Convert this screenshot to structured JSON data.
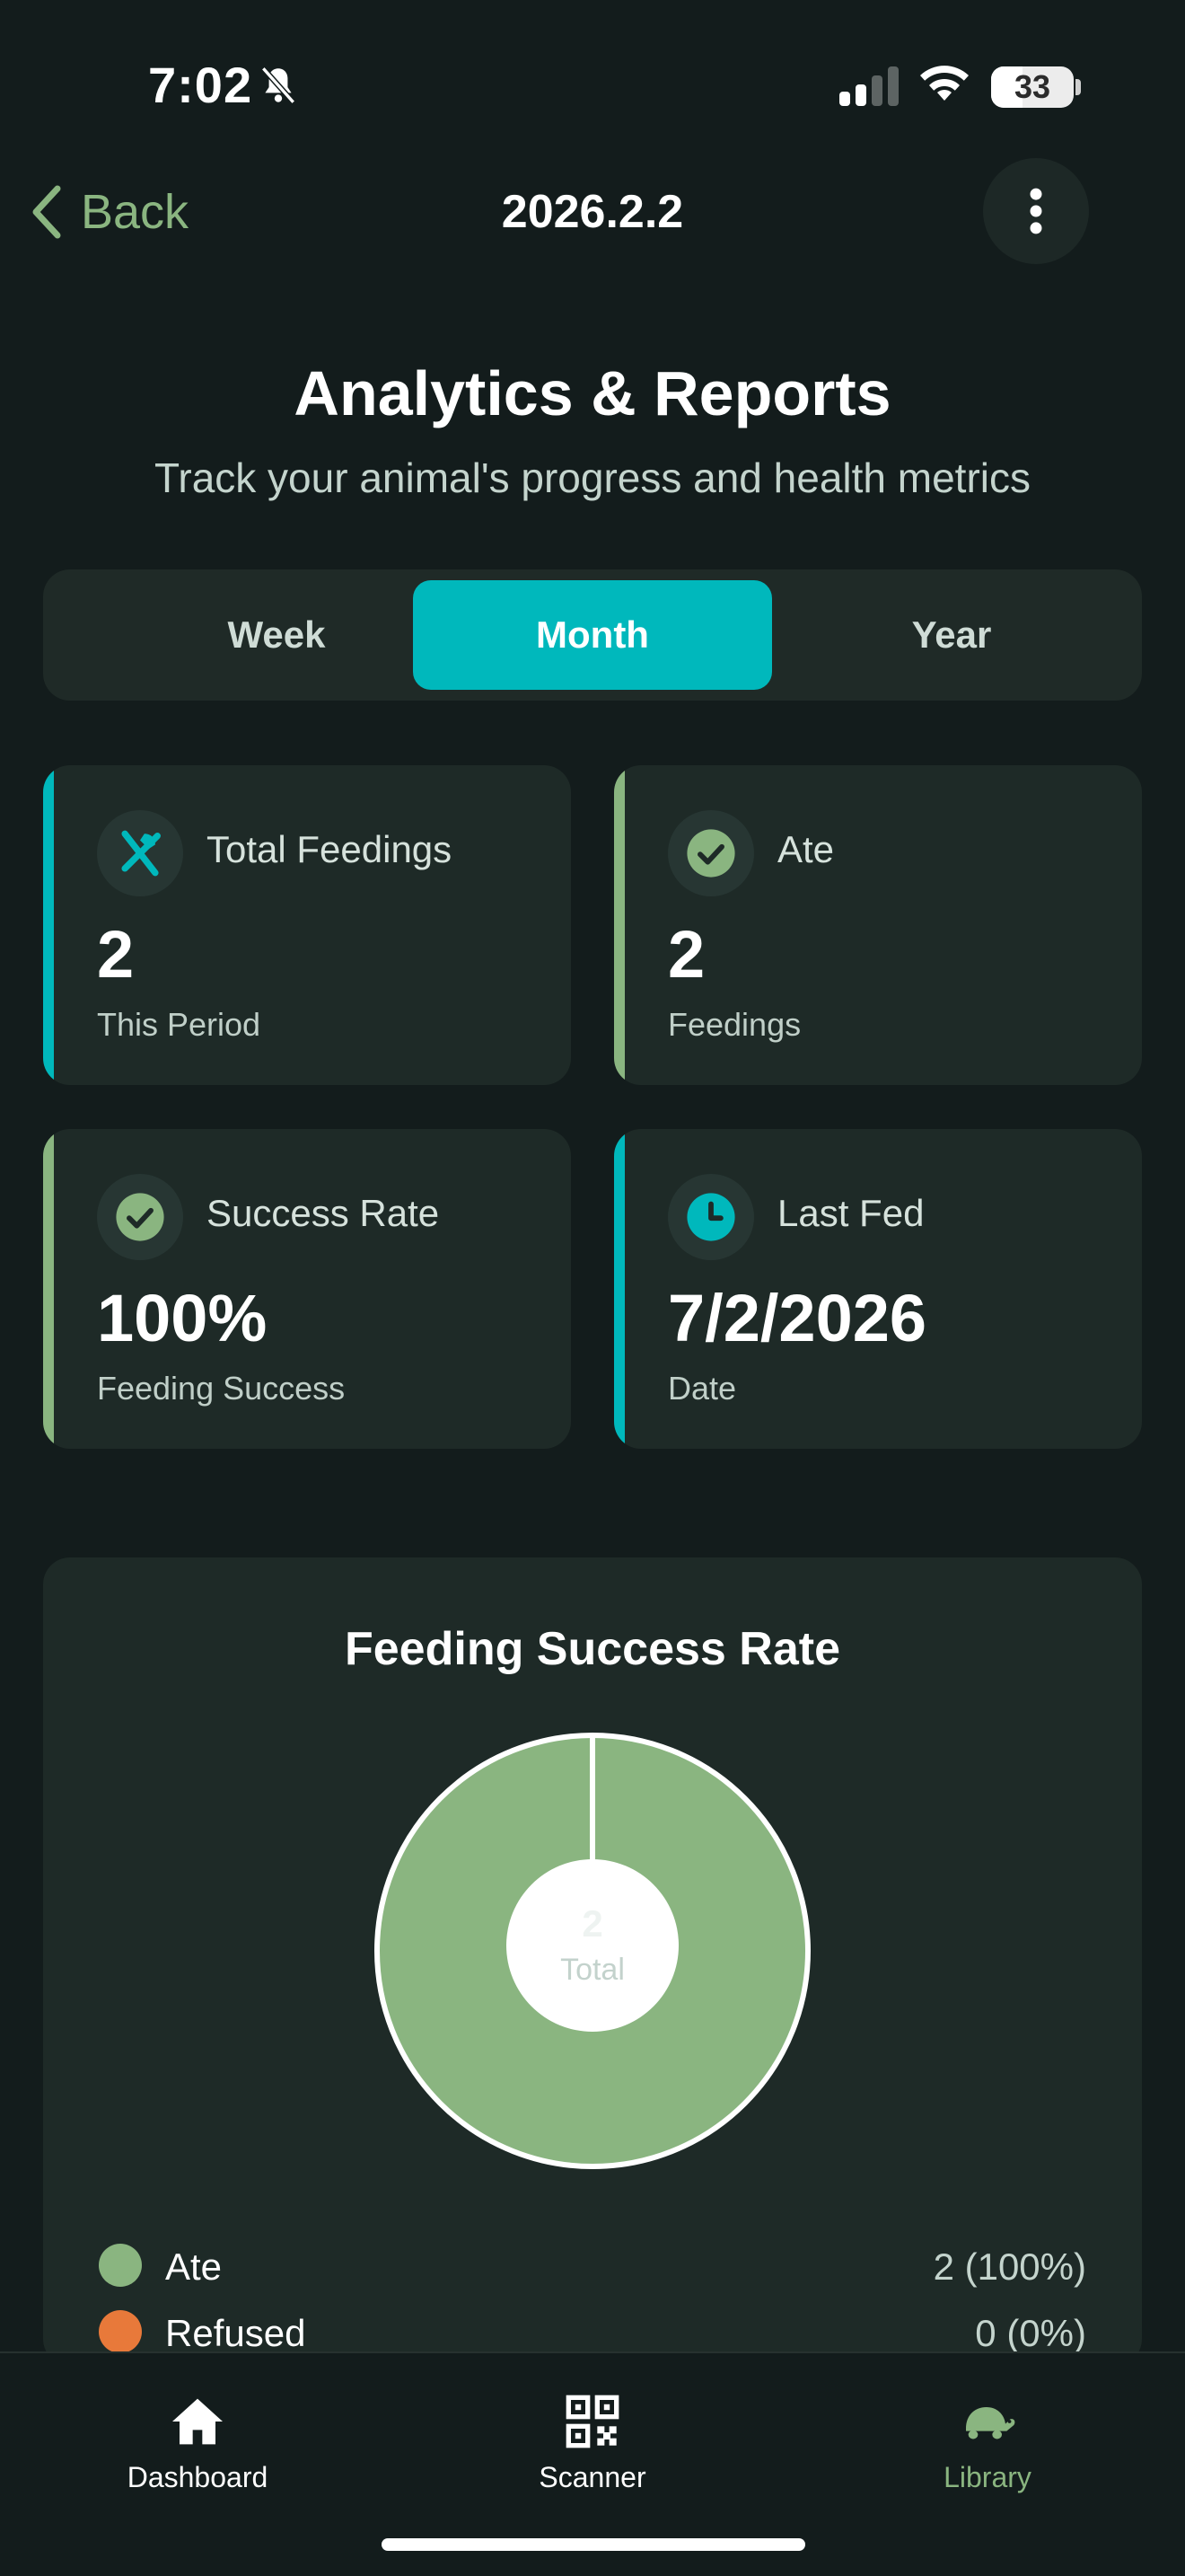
{
  "status_bar": {
    "time": "7:02",
    "battery": "33"
  },
  "nav": {
    "back_label": "Back",
    "title": "2026.2.2"
  },
  "header": {
    "title": "Analytics & Reports",
    "subtitle": "Track your animal's progress and health metrics"
  },
  "period_tabs": [
    {
      "label": "Week",
      "active": false
    },
    {
      "label": "Month",
      "active": true
    },
    {
      "label": "Year",
      "active": false
    }
  ],
  "stats": [
    {
      "label": "Total Feedings",
      "value": "2",
      "caption": "This Period",
      "icon": "fork-knife-icon",
      "accent": "#00b8bc"
    },
    {
      "label": "Ate",
      "value": "2",
      "caption": "Feedings",
      "icon": "check-circle-icon",
      "accent": "#8ab580"
    },
    {
      "label": "Success Rate",
      "value": "100%",
      "caption": "Feeding Success",
      "icon": "check-circle-icon",
      "accent": "#8ab580"
    },
    {
      "label": "Last Fed",
      "value": "7/2/2026",
      "caption": "Date",
      "icon": "clock-icon",
      "accent": "#00b8bc"
    }
  ],
  "chart_data": {
    "type": "pie",
    "title": "Feeding Success Rate",
    "center_value": "2",
    "center_label": "Total",
    "categories": [
      "Ate",
      "Refused"
    ],
    "values": [
      2,
      0
    ],
    "percents": [
      "100%",
      "0%"
    ],
    "value_labels": [
      "2 (100%)",
      "0 (0%)"
    ],
    "colors": [
      "#8ab580",
      "#e8793a"
    ],
    "legend": "bottom"
  },
  "tab_bar": {
    "items": [
      {
        "label": "Dashboard",
        "icon": "home-icon",
        "active": false
      },
      {
        "label": "Scanner",
        "icon": "qr-code-icon",
        "active": false
      },
      {
        "label": "Library",
        "icon": "turtle-icon",
        "active": true
      }
    ]
  },
  "colors": {
    "background": "#131c1c",
    "card": "#1e2a27",
    "accent_teal": "#00b8bc",
    "accent_green": "#8ab580",
    "refused_orange": "#e8793a"
  }
}
